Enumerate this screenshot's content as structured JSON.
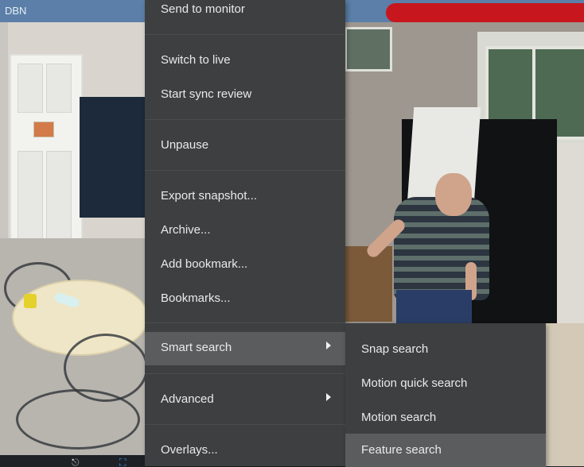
{
  "camera": {
    "label": "DBN"
  },
  "context_menu": {
    "items": [
      {
        "label": "Send to monitor"
      },
      {
        "label": "Switch to live"
      },
      {
        "label": "Start sync review"
      },
      {
        "label": "Unpause"
      },
      {
        "label": "Export snapshot..."
      },
      {
        "label": "Archive..."
      },
      {
        "label": "Add bookmark..."
      },
      {
        "label": "Bookmarks..."
      },
      {
        "label": "Smart search",
        "has_submenu": true,
        "active": true
      },
      {
        "label": "Advanced",
        "has_submenu": true
      },
      {
        "label": "Overlays..."
      }
    ]
  },
  "smart_search_submenu": {
    "items": [
      {
        "label": "Snap search"
      },
      {
        "label": "Motion quick search"
      },
      {
        "label": "Motion search"
      },
      {
        "label": "Feature search",
        "active": true
      }
    ]
  },
  "colors": {
    "menu_bg": "#3e3f41",
    "menu_active_bg": "#5b5c5e",
    "menu_text": "#e9eaec",
    "camera_header": "#5b7fa8",
    "alarm": "#c8161e"
  }
}
